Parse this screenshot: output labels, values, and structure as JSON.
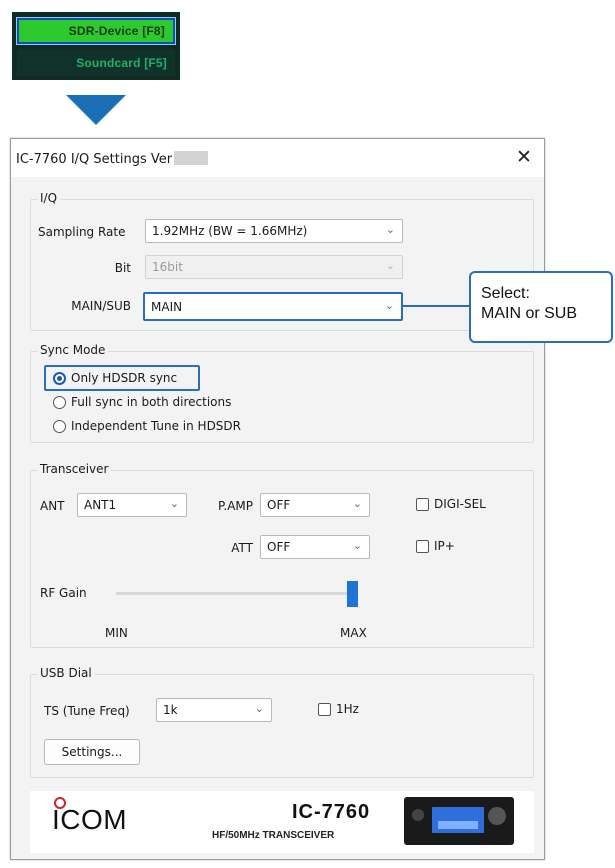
{
  "menu": {
    "items": [
      {
        "label": "SDR-Device [F8]",
        "active": true
      },
      {
        "label": "Soundcard  [F5]",
        "active": false
      }
    ],
    "accent": "#2ec92e"
  },
  "dialog": {
    "title": "IC-7760 I/Q Settings   Ver",
    "close_symbol": "✕",
    "iq": {
      "group_label": "I/Q",
      "sampling_rate_label": "Sampling Rate",
      "sampling_rate_value": "1.92MHz (BW = 1.66MHz)",
      "bit_label": "Bit",
      "bit_value": "16bit",
      "main_sub_label": "MAIN/SUB",
      "main_sub_value": "MAIN"
    },
    "sync": {
      "group_label": "Sync Mode",
      "options": [
        "Only HDSDR sync",
        "Full sync in both directions",
        "Independent Tune in HDSDR"
      ],
      "selected_index": 0
    },
    "transceiver": {
      "group_label": "Transceiver",
      "ant_label": "ANT",
      "ant_value": "ANT1",
      "pamp_label": "P.AMP",
      "pamp_value": "OFF",
      "att_label": "ATT",
      "att_value": "OFF",
      "digisel_label": "DIGI-SEL",
      "ipplus_label": "IP+",
      "rfgain_label": "RF Gain",
      "rfgain_min_label": "MIN",
      "rfgain_max_label": "MAX",
      "rfgain_level": 1.0
    },
    "usb_dial": {
      "group_label": "USB Dial",
      "ts_label": "TS (Tune Freq)",
      "ts_value": "1k",
      "onehz_label": "1Hz",
      "settings_button": "Settings..."
    },
    "footer": {
      "logo_text": "ICOM",
      "model": "IC-7760",
      "model_subtitle": "HF/50MHz TRANSCEIVER"
    }
  },
  "callout": {
    "line1": "Select:",
    "line2": "MAIN or SUB"
  },
  "colors": {
    "highlight": "#2a6fb5",
    "slider": "#1e73d6",
    "arrow": "#1a6fb6"
  }
}
